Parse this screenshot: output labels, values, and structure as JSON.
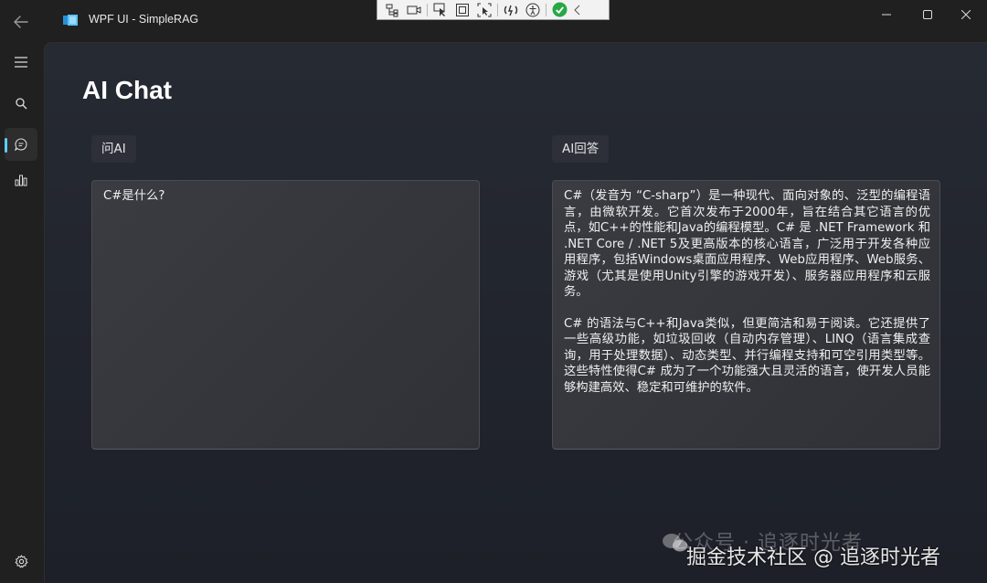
{
  "app": {
    "title": "WPF UI - SimpleRAG"
  },
  "page": {
    "title": "AI Chat"
  },
  "question": {
    "label": "问AI",
    "text": "C#是什么?"
  },
  "answer": {
    "label": "AI回答",
    "paragraphs": [
      "C#（发音为 “C-sharp”）是一种现代、面向对象的、泛型的编程语言，由微软开发。它首次发布于2000年，旨在结合其它语言的优点，如C++的性能和Java的编程模型。C# 是 .NET Framework 和 .NET Core / .NET 5及更高版本的核心语言，广泛用于开发各种应用程序，包括Windows桌面应用程序、Web应用程序、Web服务、游戏（尤其是使用Unity引擎的游戏开发）、服务器应用程序和云服务。",
      "C# 的语法与C++和Java类似，但更简洁和易于阅读。它还提供了一些高级功能，如垃圾回收（自动内存管理）、LINQ（语言集成查询，用于处理数据）、动态类型、并行编程支持和可空引用类型等。这些特性使得C# 成为了一个功能强大且灵活的语言，使开发人员能够构建高效、稳定和可维护的软件。"
    ]
  },
  "watermark": {
    "line1": "公众号 · 追逐时光者",
    "line2": "掘金技术社区 @ 追逐时光者"
  },
  "icons": {
    "back": "back-arrow-icon",
    "menu": "hamburger-menu-icon",
    "search": "search-icon",
    "chat": "chat-icon",
    "chart": "bar-chart-icon",
    "settings": "gear-icon"
  },
  "colors": {
    "accent": "#60cdff",
    "background": "#202020",
    "check": "#27a844"
  }
}
